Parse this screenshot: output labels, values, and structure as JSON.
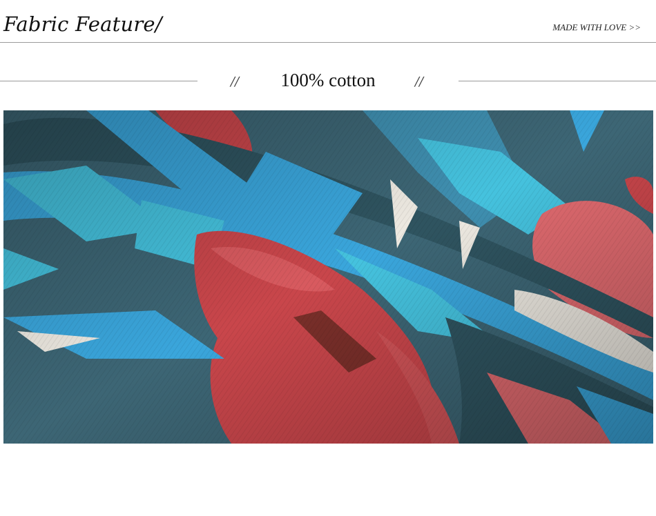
{
  "header": {
    "title": "Fabric Feature/",
    "tagline": "MADE WITH LOVE >>"
  },
  "section": {
    "slash_left": "//",
    "label": "100% cotton",
    "slash_right": "//"
  },
  "photo": {
    "subject": "fabric-closeup-image",
    "colors": {
      "base": "#3d6675",
      "teal_dark": "#2f5460",
      "blue": "#3aa6dc",
      "cyan": "#45c2de",
      "red": "#c9464b",
      "coral": "#e06a6f",
      "cream": "#eeeae2"
    }
  }
}
